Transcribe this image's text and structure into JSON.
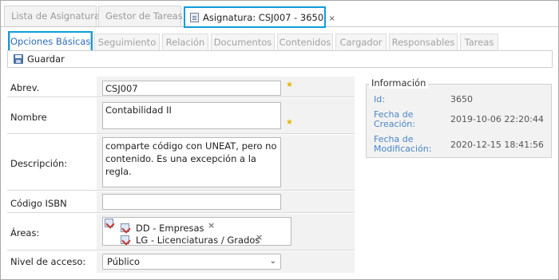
{
  "top_tabs": [
    {
      "label": "Lista de Asignaturas"
    },
    {
      "label": "Gestor de Tareas"
    },
    {
      "label": "Asignatura: CSJ007 - 3650",
      "close": "×"
    }
  ],
  "sub_tabs": [
    {
      "label": "Opciones Básicas"
    },
    {
      "label": "Seguimiento"
    },
    {
      "label": "Relación"
    },
    {
      "label": "Documentos"
    },
    {
      "label": "Contenidos"
    },
    {
      "label": "Cargador"
    },
    {
      "label": "Responsables"
    },
    {
      "label": "Tareas"
    }
  ],
  "toolbar": {
    "save_label": "Guardar"
  },
  "form": {
    "abrev": {
      "label": "Abrev.",
      "value": "CSJ007"
    },
    "nombre": {
      "label": "Nombre",
      "value": "Contabilidad II"
    },
    "descripcion": {
      "label": "Descripción:",
      "value": "comparte código con UNEAT, pero no contenido. Es una excepción a la regla."
    },
    "isbn": {
      "label": "Código ISBN",
      "value": ""
    },
    "areas": {
      "label": "Áreas:",
      "items": [
        "DD - Empresas",
        "LG - Licenciaturas / Grados"
      ],
      "remove": "×"
    },
    "nivel": {
      "label": "Nivel de acceso:",
      "value": "Público"
    }
  },
  "info": {
    "legend": "Información",
    "id_label": "Id:",
    "id_value": "3650",
    "creacion_label_1": "Fecha de",
    "creacion_label_2": "Creación:",
    "creacion_value": "2019-10-06 22:20:44",
    "modificacion_label_1": "Fecha de",
    "modificacion_label_2": "Modificación:",
    "modificacion_value": "2020-12-15 18:41:56"
  },
  "colors": {
    "accent": "#0d9ddb",
    "link": "#2e6db8",
    "required_star": "#e8b400"
  }
}
